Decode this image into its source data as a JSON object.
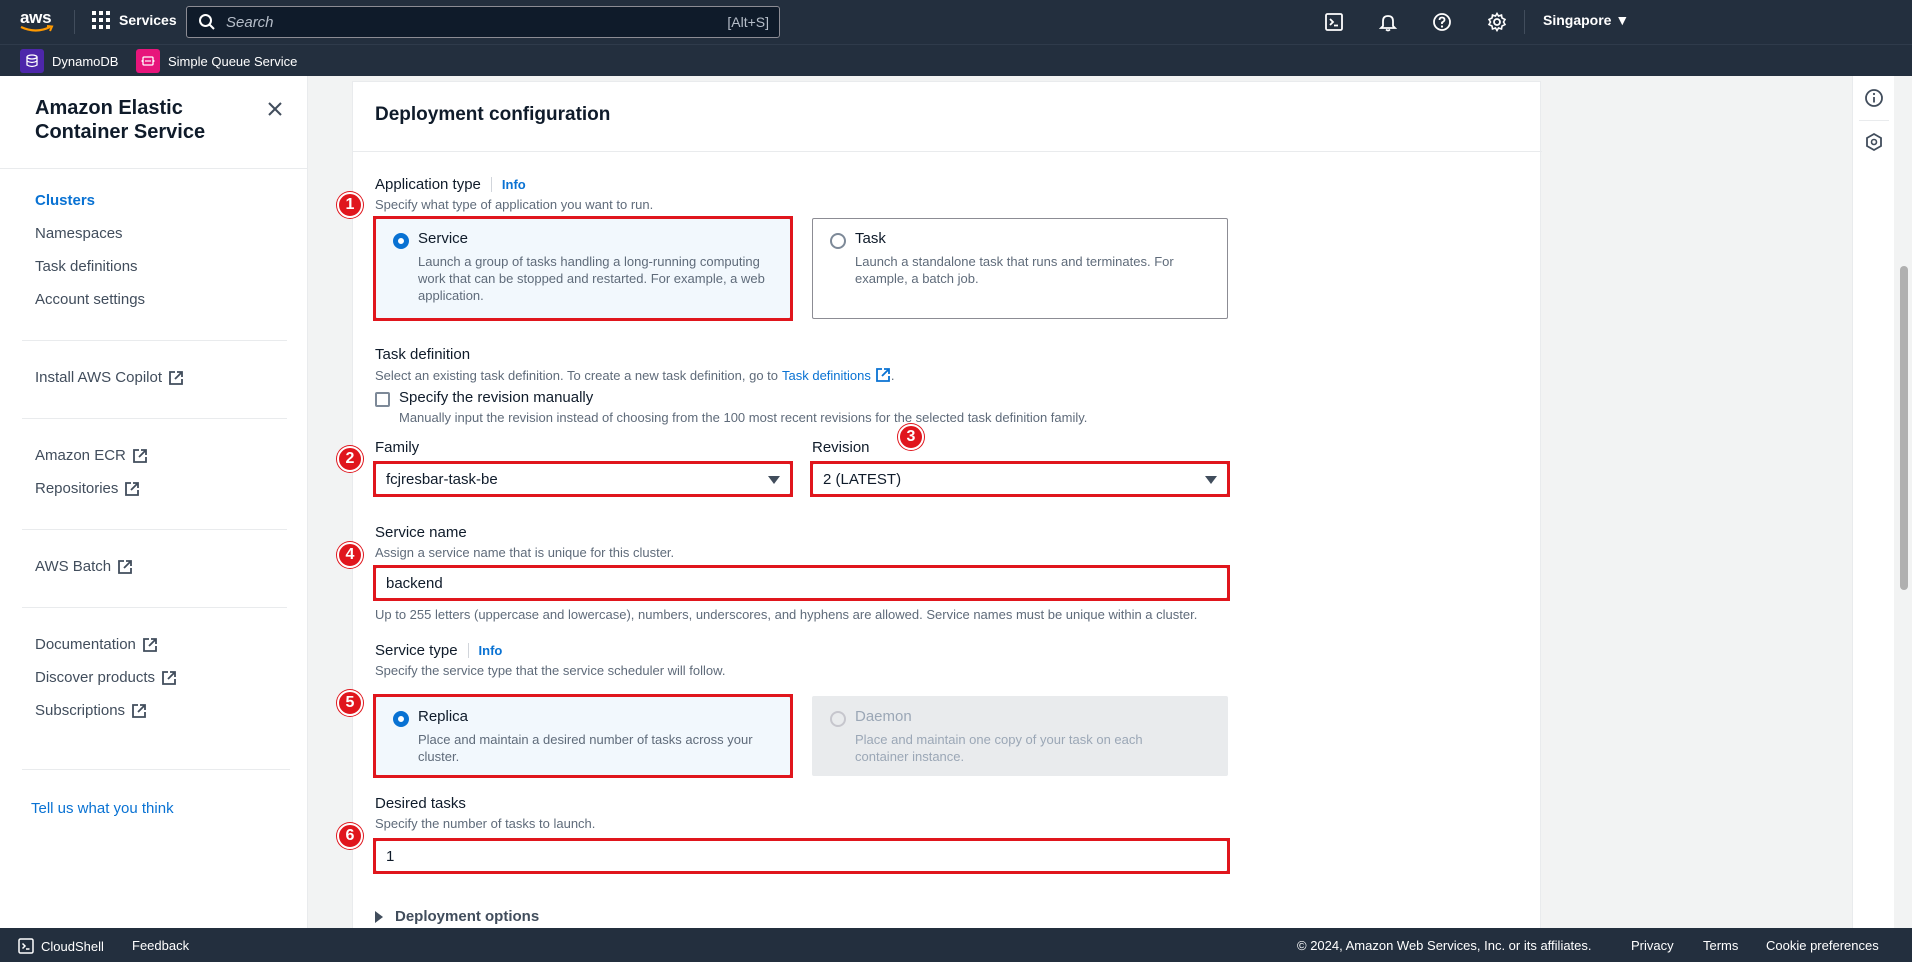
{
  "topnav": {
    "logo_text": "aws",
    "services_label": "Services",
    "search_placeholder": "Search",
    "search_shortcut": "[Alt+S]",
    "region": "Singapore ▼",
    "icons": [
      "cloudshell-icon",
      "bell-icon",
      "help-icon",
      "gear-icon"
    ]
  },
  "favorites": [
    {
      "label": "DynamoDB",
      "icon": "dynamodb-icon",
      "color": "#4d27aa"
    },
    {
      "label": "Simple Queue Service",
      "icon": "sqs-icon",
      "color": "#e7157b"
    }
  ],
  "sidebar": {
    "title": "Amazon Elastic Container Service",
    "items": [
      {
        "label": "Clusters",
        "active": true
      },
      {
        "label": "Namespaces"
      },
      {
        "label": "Task definitions"
      },
      {
        "label": "Account settings"
      },
      {
        "label": "Install AWS Copilot",
        "external": true
      },
      {
        "label": "Amazon ECR",
        "external": true
      },
      {
        "label": "Repositories",
        "external": true
      },
      {
        "label": "AWS Batch",
        "external": true
      },
      {
        "label": "Documentation",
        "external": true
      },
      {
        "label": "Discover products",
        "external": true
      },
      {
        "label": "Subscriptions",
        "external": true
      }
    ],
    "feedback": "Tell us what you think"
  },
  "main": {
    "section_title": "Deployment configuration",
    "application_type": {
      "label": "Application type",
      "info": "Info",
      "description": "Specify what type of application you want to run.",
      "options": [
        {
          "title": "Service",
          "description": "Launch a group of tasks handling a long-running computing work that can be stopped and restarted. For example, a web application.",
          "selected": true
        },
        {
          "title": "Task",
          "description": "Launch a standalone task that runs and terminates. For example, a batch job.",
          "selected": false
        }
      ]
    },
    "task_definition": {
      "label": "Task definition",
      "description_prefix": "Select an existing task definition. To create a new task definition, go to",
      "description_link": "Task definitions",
      "description_suffix": ".",
      "manual_checkbox_label": "Specify the revision manually",
      "manual_checkbox_description": "Manually input the revision instead of choosing from the 100 most recent revisions for the selected task definition family.",
      "family_label": "Family",
      "family_value": "fcjresbar-task-be",
      "revision_label": "Revision",
      "revision_value": "2 (LATEST)"
    },
    "service_name": {
      "label": "Service name",
      "description": "Assign a service name that is unique for this cluster.",
      "value": "backend",
      "constraint": "Up to 255 letters (uppercase and lowercase), numbers, underscores, and hyphens are allowed. Service names must be unique within a cluster."
    },
    "service_type": {
      "label": "Service type",
      "info": "Info",
      "description": "Specify the service type that the service scheduler will follow.",
      "options": [
        {
          "title": "Replica",
          "description": "Place and maintain a desired number of tasks across your cluster.",
          "selected": true,
          "disabled": false
        },
        {
          "title": "Daemon",
          "description": "Place and maintain one copy of your task on each container instance.",
          "selected": false,
          "disabled": true
        }
      ]
    },
    "desired_tasks": {
      "label": "Desired tasks",
      "description": "Specify the number of tasks to launch.",
      "value": "1"
    },
    "deployment_options": "Deployment options",
    "annotations": [
      "1",
      "2",
      "3",
      "4",
      "5",
      "6"
    ],
    "annotation_color": "#e0161d"
  },
  "footer": {
    "cloudshell": "CloudShell",
    "feedback": "Feedback",
    "copyright": "© 2024, Amazon Web Services, Inc. or its affiliates.",
    "links": [
      "Privacy",
      "Terms",
      "Cookie preferences"
    ]
  },
  "colors": {
    "nav_bg": "#232f3e",
    "link": "#0972d3",
    "selected_tile_bg": "#f2f8fd"
  }
}
